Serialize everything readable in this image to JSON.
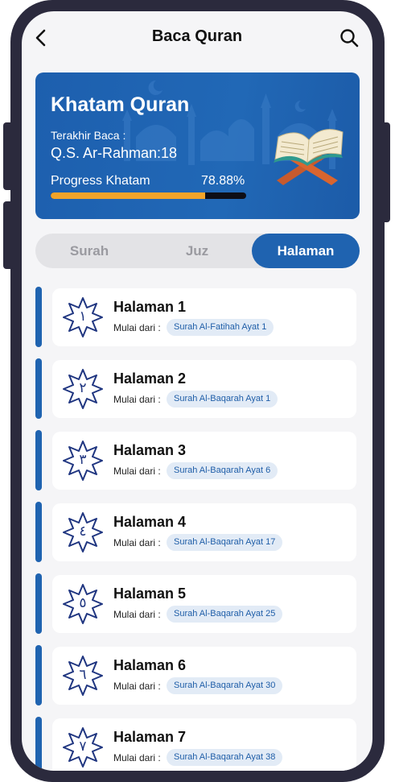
{
  "header": {
    "title": "Baca Quran",
    "back_icon": "chevron-left-icon",
    "search_icon": "search-icon"
  },
  "banner": {
    "title": "Khatam Quran",
    "last_read_label": "Terakhir Baca :",
    "last_read_value": "Q.S. Ar-Rahman:18",
    "progress_label": "Progress Khatam",
    "progress_value": "78.88%",
    "progress_fraction": 0.7888,
    "colors": {
      "background": "#1f63b0",
      "progress_fill": "#f2a42a",
      "progress_track": "#0e0e16"
    }
  },
  "tabs": [
    {
      "label": "Surah",
      "active": false
    },
    {
      "label": "Juz",
      "active": false
    },
    {
      "label": "Halaman",
      "active": true
    }
  ],
  "pages": [
    {
      "number_arabic": "١",
      "title": "Halaman 1",
      "from_label": "Mulai dari :",
      "from": "Surah Al-Fatihah Ayat 1"
    },
    {
      "number_arabic": "٢",
      "title": "Halaman 2",
      "from_label": "Mulai dari :",
      "from": "Surah Al-Baqarah Ayat 1"
    },
    {
      "number_arabic": "٣",
      "title": "Halaman 3",
      "from_label": "Mulai dari :",
      "from": "Surah Al-Baqarah Ayat 6"
    },
    {
      "number_arabic": "٤",
      "title": "Halaman 4",
      "from_label": "Mulai dari :",
      "from": "Surah Al-Baqarah Ayat 17"
    },
    {
      "number_arabic": "٥",
      "title": "Halaman 5",
      "from_label": "Mulai dari :",
      "from": "Surah Al-Baqarah Ayat 25"
    },
    {
      "number_arabic": "٦",
      "title": "Halaman 6",
      "from_label": "Mulai dari :",
      "from": "Surah Al-Baqarah Ayat 30"
    },
    {
      "number_arabic": "٧",
      "title": "Halaman 7",
      "from_label": "Mulai dari :",
      "from": "Surah Al-Baqarah Ayat 38"
    }
  ]
}
